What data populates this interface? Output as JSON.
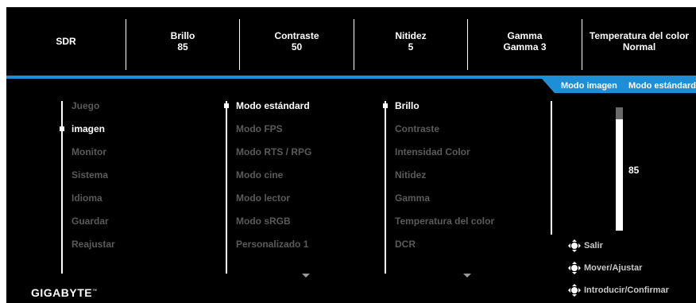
{
  "top_bar": {
    "items": [
      {
        "label": "SDR",
        "value": ""
      },
      {
        "label": "Brillo",
        "value": "85"
      },
      {
        "label": "Contraste",
        "value": "50"
      },
      {
        "label": "Nitidez",
        "value": "5"
      },
      {
        "label": "Gamma",
        "value": "Gamma 3"
      },
      {
        "label": "Temperatura del color",
        "value": "Normal"
      }
    ]
  },
  "mode_tab": {
    "label": "Modo imagen",
    "value": "Modo estándard"
  },
  "main_menu": {
    "items": [
      "Juego",
      "imagen",
      "Monitor",
      "Sistema",
      "Idioma",
      "Guardar",
      "Reajustar"
    ],
    "selected": "imagen"
  },
  "mode_menu": {
    "items": [
      "Modo estándard",
      "Modo FPS",
      "Modo RTS / RPG",
      "Modo cine",
      "Modo lector",
      "Modo sRGB",
      "Personalizado 1"
    ],
    "selected": "Modo estándard"
  },
  "setting_menu": {
    "items": [
      "Brillo",
      "Contraste",
      "Intensidad Color",
      "Nitidez",
      "Gamma",
      "Temperatura del color",
      "DCR"
    ],
    "selected": "Brillo"
  },
  "slider": {
    "value": "85",
    "fraction": 0.85
  },
  "hints": {
    "exit": "Salir",
    "move": "Mover/Ajustar",
    "confirm": "Introducir/Confirmar"
  },
  "icons": [
    "joystick-icon",
    "chevron-down-icon"
  ],
  "colors": {
    "accent": "#1e8fd6",
    "background": "#000000",
    "inactive_text": "#5a5a5a"
  },
  "brand": "GIGABYTE"
}
